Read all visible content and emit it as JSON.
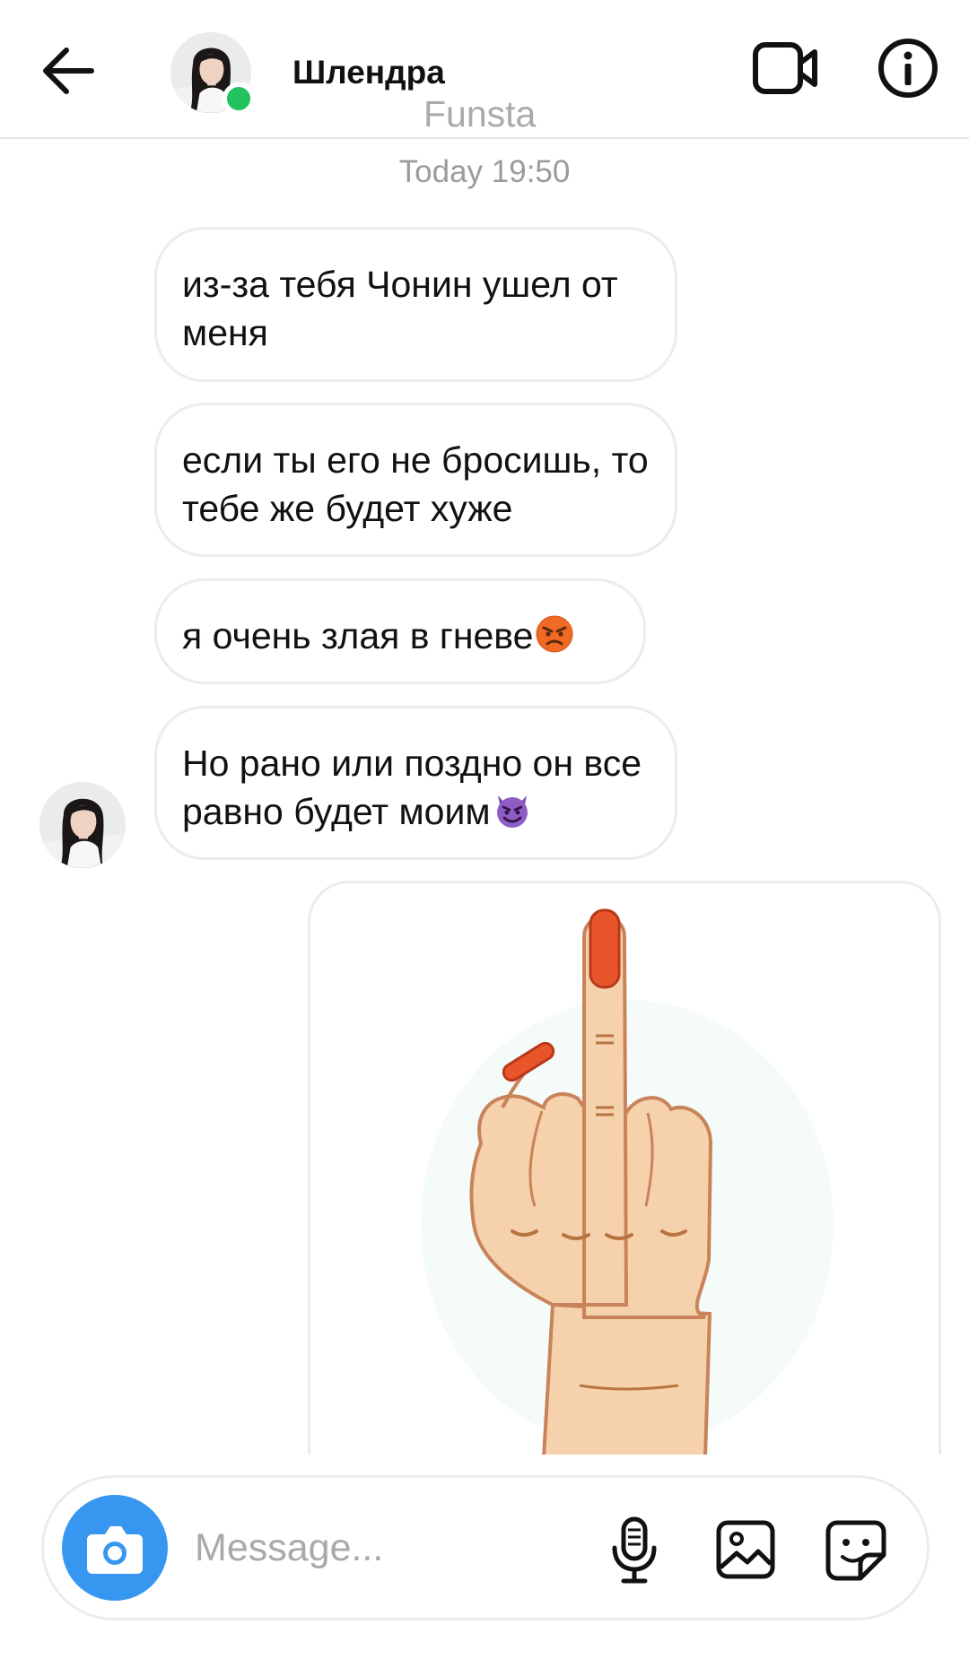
{
  "header": {
    "contact_name": "Шлендра",
    "contact_subtitle": "Funsta",
    "back_icon": "arrow-left-icon",
    "video_icon": "video-camera-icon",
    "info_icon": "info-icon",
    "online_color": "#22c35e"
  },
  "thread": {
    "timestamp": "Today 19:50",
    "messages": [
      {
        "text": "из-за тебя Чонин ушел от меня"
      },
      {
        "text": "если ты его не бросишь, то тебе же будет хуже"
      },
      {
        "text": "я очень злая в гневе",
        "emoji": "angry-face-emoji"
      },
      {
        "text": "Но рано или поздно он все равно будет моим",
        "emoji": "smiling-devil-emoji"
      }
    ],
    "image_message": {
      "icon": "middle-finger-hand-image"
    }
  },
  "composer": {
    "placeholder": "Message...",
    "camera_icon": "camera-icon",
    "mic_icon": "microphone-icon",
    "gallery_icon": "gallery-icon",
    "sticker_icon": "sticker-icon",
    "accent_color": "#3797f0"
  }
}
